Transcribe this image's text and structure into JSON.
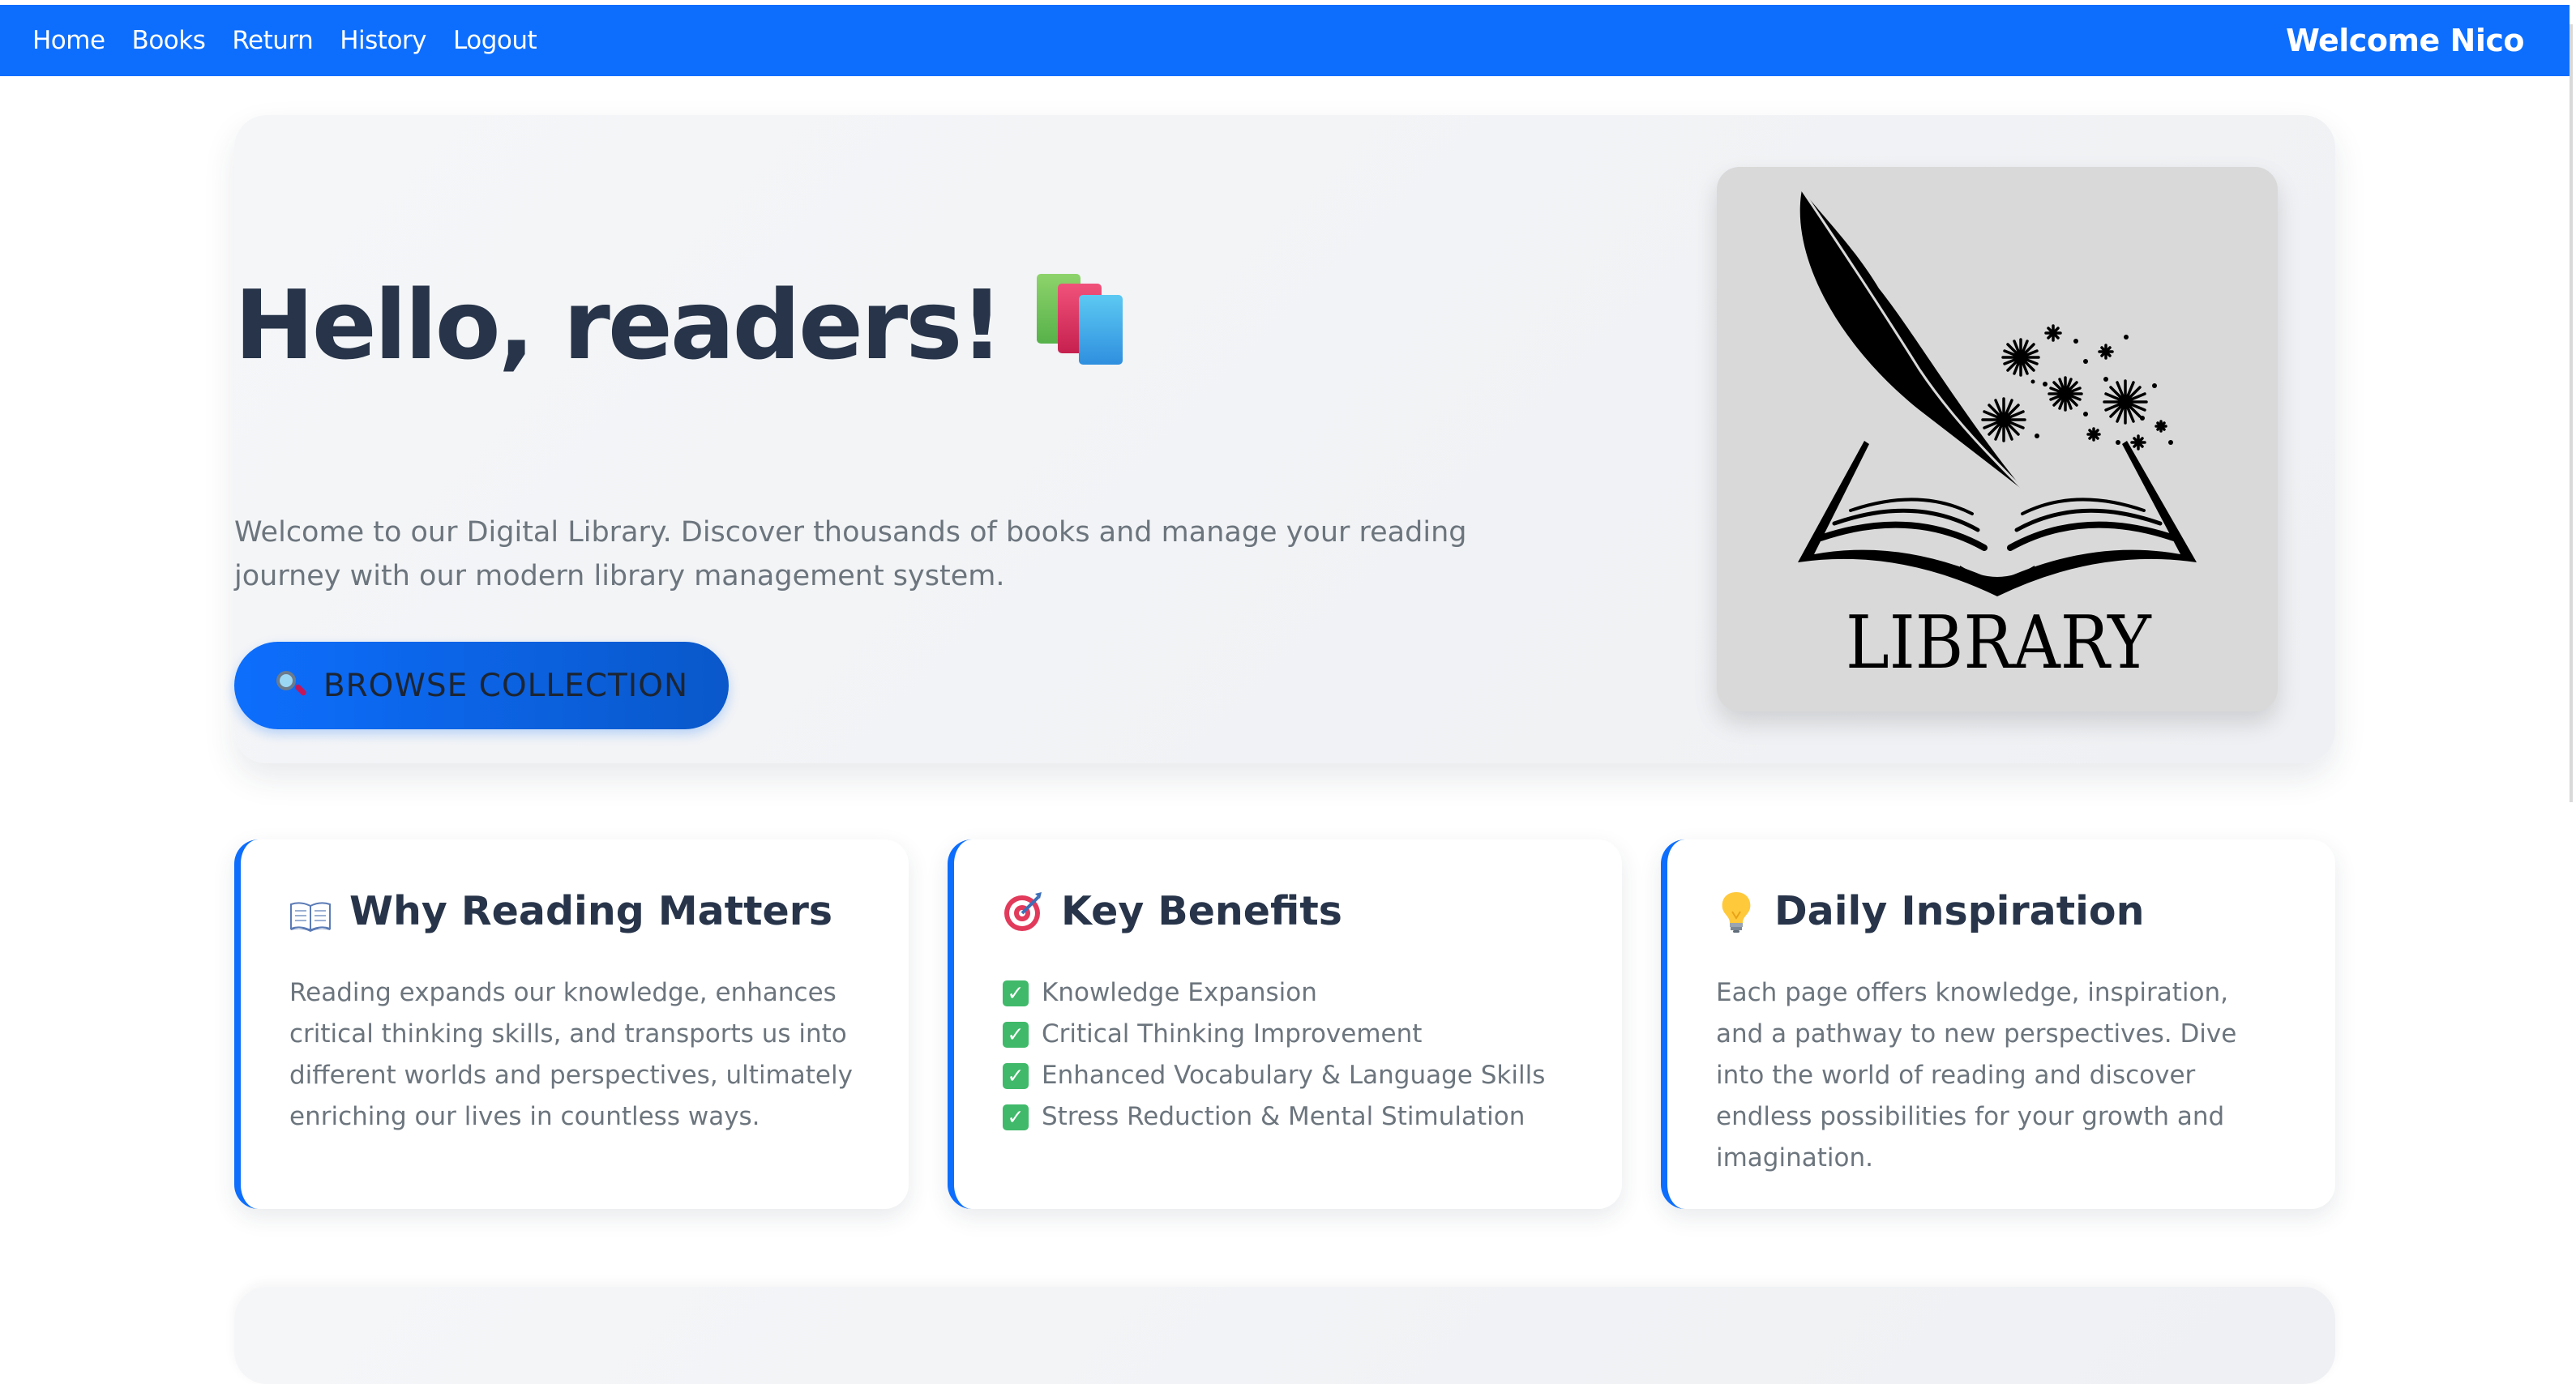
{
  "nav": {
    "links": [
      "Home",
      "Books",
      "Return",
      "History",
      "Logout"
    ],
    "welcome": "Welcome Nico"
  },
  "hero": {
    "title": "Hello, readers!",
    "title_icon": "books-icon",
    "description": "Welcome to our Digital Library. Discover thousands of books and manage your reading journey with our modern library management system.",
    "button_label": "BROWSE COLLECTION",
    "button_icon": "magnifier-icon",
    "image_text": "LIBRARY"
  },
  "cards": [
    {
      "icon": "open-book-icon",
      "title": "Why Reading Matters",
      "body": "Reading expands our knowledge, enhances critical thinking skills, and transports us into different worlds and perspectives, ultimately enriching our lives in countless ways."
    },
    {
      "icon": "target-icon",
      "title": "Key Benefits",
      "items": [
        "Knowledge Expansion",
        "Critical Thinking Improvement",
        "Enhanced Vocabulary & Language Skills",
        "Stress Reduction & Mental Stimulation"
      ]
    },
    {
      "icon": "light-bulb-icon",
      "title": "Daily Inspiration",
      "body": "Each page offers knowledge, inspiration, and a pathway to new perspectives. Dive into the world of reading and discover endless possibilities for your growth and imagination."
    }
  ],
  "colors": {
    "primary": "#0d6efd",
    "heading": "#273449",
    "muted": "#6c757d",
    "check": "#40b96a"
  }
}
